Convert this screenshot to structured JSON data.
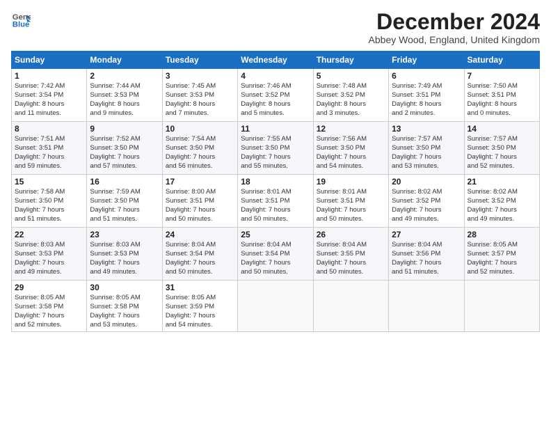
{
  "header": {
    "logo_line1": "General",
    "logo_line2": "Blue",
    "month": "December 2024",
    "location": "Abbey Wood, England, United Kingdom"
  },
  "days_of_week": [
    "Sunday",
    "Monday",
    "Tuesday",
    "Wednesday",
    "Thursday",
    "Friday",
    "Saturday"
  ],
  "weeks": [
    [
      {
        "day": "1",
        "info": "Sunrise: 7:42 AM\nSunset: 3:54 PM\nDaylight: 8 hours\nand 11 minutes."
      },
      {
        "day": "2",
        "info": "Sunrise: 7:44 AM\nSunset: 3:53 PM\nDaylight: 8 hours\nand 9 minutes."
      },
      {
        "day": "3",
        "info": "Sunrise: 7:45 AM\nSunset: 3:53 PM\nDaylight: 8 hours\nand 7 minutes."
      },
      {
        "day": "4",
        "info": "Sunrise: 7:46 AM\nSunset: 3:52 PM\nDaylight: 8 hours\nand 5 minutes."
      },
      {
        "day": "5",
        "info": "Sunrise: 7:48 AM\nSunset: 3:52 PM\nDaylight: 8 hours\nand 3 minutes."
      },
      {
        "day": "6",
        "info": "Sunrise: 7:49 AM\nSunset: 3:51 PM\nDaylight: 8 hours\nand 2 minutes."
      },
      {
        "day": "7",
        "info": "Sunrise: 7:50 AM\nSunset: 3:51 PM\nDaylight: 8 hours\nand 0 minutes."
      }
    ],
    [
      {
        "day": "8",
        "info": "Sunrise: 7:51 AM\nSunset: 3:51 PM\nDaylight: 7 hours\nand 59 minutes."
      },
      {
        "day": "9",
        "info": "Sunrise: 7:52 AM\nSunset: 3:50 PM\nDaylight: 7 hours\nand 57 minutes."
      },
      {
        "day": "10",
        "info": "Sunrise: 7:54 AM\nSunset: 3:50 PM\nDaylight: 7 hours\nand 56 minutes."
      },
      {
        "day": "11",
        "info": "Sunrise: 7:55 AM\nSunset: 3:50 PM\nDaylight: 7 hours\nand 55 minutes."
      },
      {
        "day": "12",
        "info": "Sunrise: 7:56 AM\nSunset: 3:50 PM\nDaylight: 7 hours\nand 54 minutes."
      },
      {
        "day": "13",
        "info": "Sunrise: 7:57 AM\nSunset: 3:50 PM\nDaylight: 7 hours\nand 53 minutes."
      },
      {
        "day": "14",
        "info": "Sunrise: 7:57 AM\nSunset: 3:50 PM\nDaylight: 7 hours\nand 52 minutes."
      }
    ],
    [
      {
        "day": "15",
        "info": "Sunrise: 7:58 AM\nSunset: 3:50 PM\nDaylight: 7 hours\nand 51 minutes."
      },
      {
        "day": "16",
        "info": "Sunrise: 7:59 AM\nSunset: 3:50 PM\nDaylight: 7 hours\nand 51 minutes."
      },
      {
        "day": "17",
        "info": "Sunrise: 8:00 AM\nSunset: 3:51 PM\nDaylight: 7 hours\nand 50 minutes."
      },
      {
        "day": "18",
        "info": "Sunrise: 8:01 AM\nSunset: 3:51 PM\nDaylight: 7 hours\nand 50 minutes."
      },
      {
        "day": "19",
        "info": "Sunrise: 8:01 AM\nSunset: 3:51 PM\nDaylight: 7 hours\nand 50 minutes."
      },
      {
        "day": "20",
        "info": "Sunrise: 8:02 AM\nSunset: 3:52 PM\nDaylight: 7 hours\nand 49 minutes."
      },
      {
        "day": "21",
        "info": "Sunrise: 8:02 AM\nSunset: 3:52 PM\nDaylight: 7 hours\nand 49 minutes."
      }
    ],
    [
      {
        "day": "22",
        "info": "Sunrise: 8:03 AM\nSunset: 3:53 PM\nDaylight: 7 hours\nand 49 minutes."
      },
      {
        "day": "23",
        "info": "Sunrise: 8:03 AM\nSunset: 3:53 PM\nDaylight: 7 hours\nand 49 minutes."
      },
      {
        "day": "24",
        "info": "Sunrise: 8:04 AM\nSunset: 3:54 PM\nDaylight: 7 hours\nand 50 minutes."
      },
      {
        "day": "25",
        "info": "Sunrise: 8:04 AM\nSunset: 3:54 PM\nDaylight: 7 hours\nand 50 minutes."
      },
      {
        "day": "26",
        "info": "Sunrise: 8:04 AM\nSunset: 3:55 PM\nDaylight: 7 hours\nand 50 minutes."
      },
      {
        "day": "27",
        "info": "Sunrise: 8:04 AM\nSunset: 3:56 PM\nDaylight: 7 hours\nand 51 minutes."
      },
      {
        "day": "28",
        "info": "Sunrise: 8:05 AM\nSunset: 3:57 PM\nDaylight: 7 hours\nand 52 minutes."
      }
    ],
    [
      {
        "day": "29",
        "info": "Sunrise: 8:05 AM\nSunset: 3:58 PM\nDaylight: 7 hours\nand 52 minutes."
      },
      {
        "day": "30",
        "info": "Sunrise: 8:05 AM\nSunset: 3:58 PM\nDaylight: 7 hours\nand 53 minutes."
      },
      {
        "day": "31",
        "info": "Sunrise: 8:05 AM\nSunset: 3:59 PM\nDaylight: 7 hours\nand 54 minutes."
      },
      null,
      null,
      null,
      null
    ]
  ]
}
